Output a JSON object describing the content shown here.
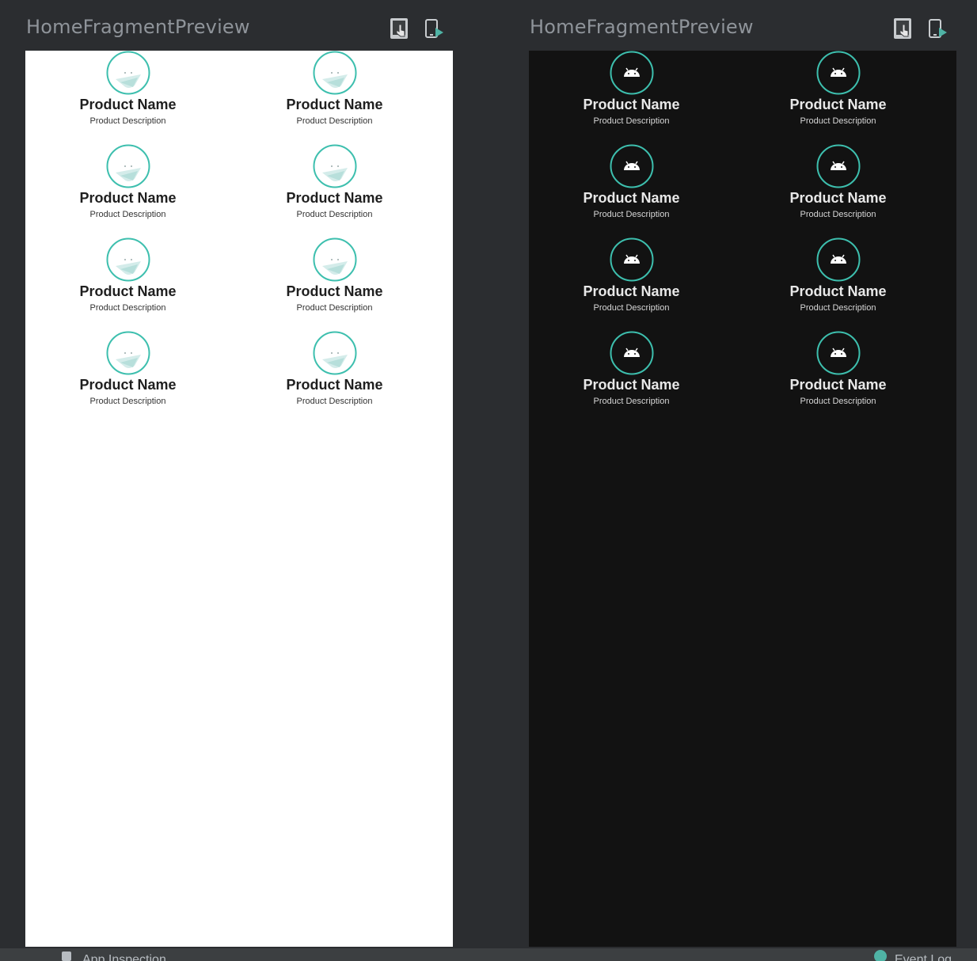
{
  "panels": [
    {
      "title": "HomeFragmentPreview",
      "theme": "light",
      "toolbar_icons": [
        "interactive-mode-icon",
        "deploy-to-device-icon"
      ],
      "items": [
        {
          "name": "Product Name",
          "description": "Product Description"
        },
        {
          "name": "Product Name",
          "description": "Product Description"
        },
        {
          "name": "Product Name",
          "description": "Product Description"
        },
        {
          "name": "Product Name",
          "description": "Product Description"
        },
        {
          "name": "Product Name",
          "description": "Product Description"
        },
        {
          "name": "Product Name",
          "description": "Product Description"
        },
        {
          "name": "Product Name",
          "description": "Product Description"
        },
        {
          "name": "Product Name",
          "description": "Product Description"
        }
      ]
    },
    {
      "title": "HomeFragmentPreview",
      "theme": "dark",
      "toolbar_icons": [
        "interactive-mode-icon",
        "deploy-to-device-icon"
      ],
      "items": [
        {
          "name": "Product Name",
          "description": "Product Description"
        },
        {
          "name": "Product Name",
          "description": "Product Description"
        },
        {
          "name": "Product Name",
          "description": "Product Description"
        },
        {
          "name": "Product Name",
          "description": "Product Description"
        },
        {
          "name": "Product Name",
          "description": "Product Description"
        },
        {
          "name": "Product Name",
          "description": "Product Description"
        },
        {
          "name": "Product Name",
          "description": "Product Description"
        },
        {
          "name": "Product Name",
          "description": "Product Description"
        }
      ]
    }
  ],
  "colors": {
    "ide_background": "#2b2d30",
    "accent_teal": "#3dbfae",
    "light_canvas": "#ffffff",
    "dark_canvas": "#121212",
    "title_text": "#8f949a"
  },
  "status_bar": {
    "left_fragment": "App Inspection",
    "right_fragment": "Event Log"
  }
}
